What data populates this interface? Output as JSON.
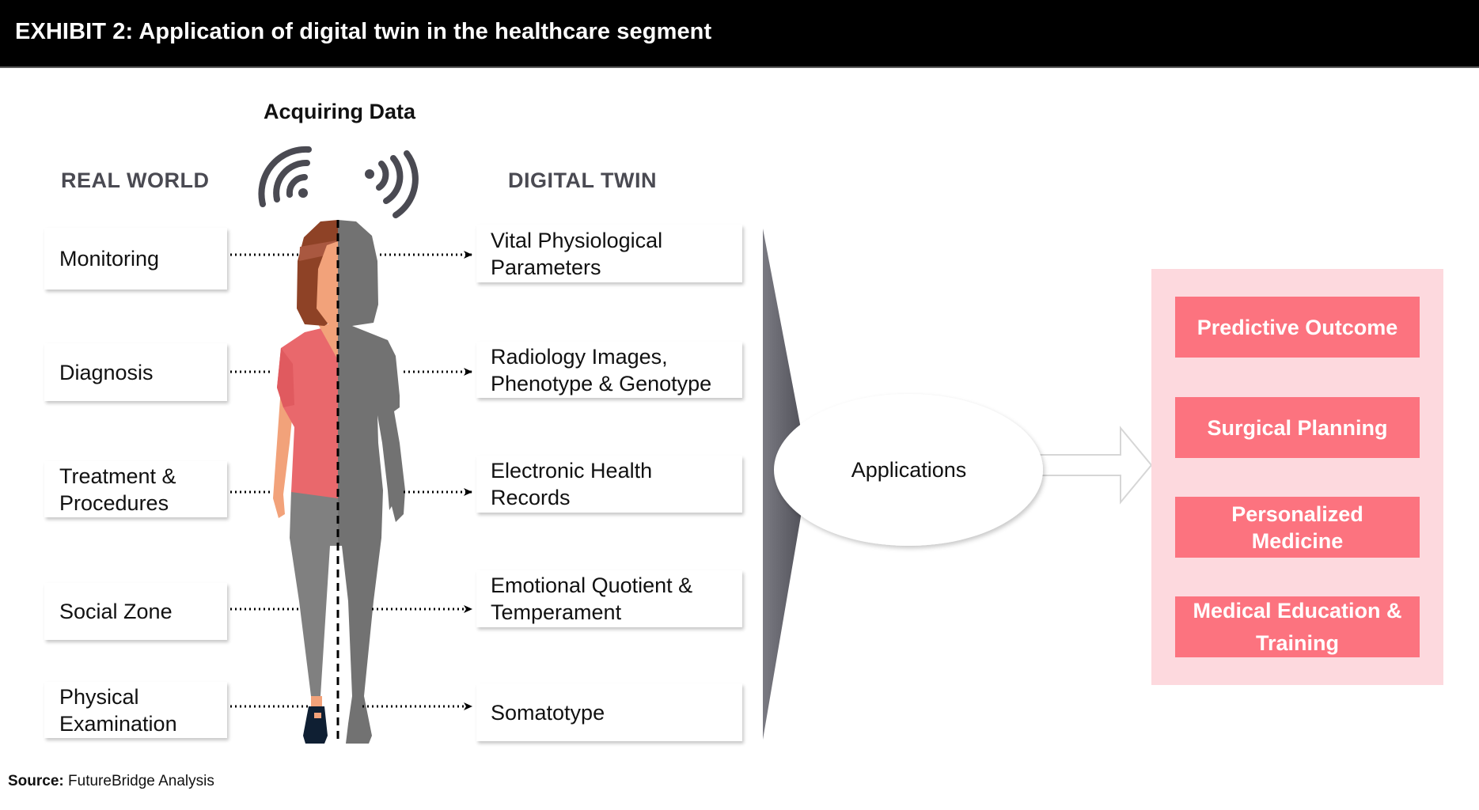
{
  "header": {
    "title": "EXHIBIT 2: Application of digital twin in the healthcare segment"
  },
  "acquiring_data_label": "Acquiring Data",
  "icons": {
    "left_signal": "wifi-signal-icon",
    "right_signal": "broadcast-signal-icon",
    "figure": "woman-figure-icon"
  },
  "real_world": {
    "title": "REAL WORLD",
    "items": [
      "Monitoring",
      "Diagnosis",
      "Treatment & Procedures",
      "Social Zone",
      "Physical Examination"
    ]
  },
  "digital_twin": {
    "title": "DIGITAL TWIN",
    "items": [
      "Vital Physiological Parameters",
      "Radiology Images, Phenotype & Genotype",
      "Electronic Health Records",
      "Emotional Quotient & Temperament",
      "Somatotype"
    ]
  },
  "hub": {
    "label": "Applications"
  },
  "applications": {
    "items": [
      "Predictive Outcome",
      "Surgical Planning",
      "Personalized Medicine",
      "Medical Education & Training"
    ]
  },
  "colors": {
    "header_bg": "#000000",
    "section_label": "#4a4a52",
    "panel_bg": "#fdd9de",
    "app_button_bg": "#fc737f",
    "hair": "#8e4226",
    "skin": "#f2a27a",
    "shirt": "#e9686c",
    "pants": "#808080",
    "twin_silhouette": "#727272",
    "shoe": "#0f1f33",
    "signal_icon": "#4a4a52"
  },
  "source": {
    "label": "Source:",
    "text": "FutureBridge Analysis"
  }
}
